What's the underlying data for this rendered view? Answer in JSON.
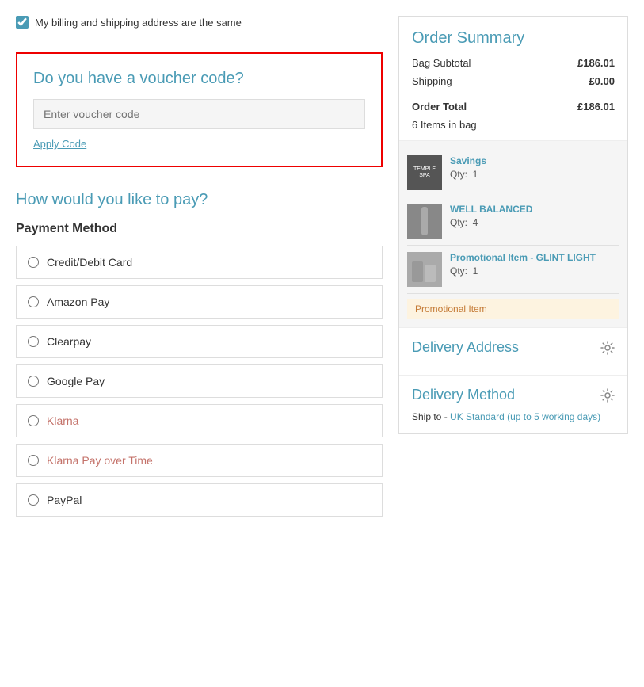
{
  "billing": {
    "checkbox_label": "My billing and shipping address are the same",
    "checked": true
  },
  "voucher": {
    "title": "Do you have a voucher code?",
    "input_placeholder": "Enter voucher code",
    "apply_label": "Apply Code"
  },
  "payment": {
    "how_to_pay_title": "How would you like to pay?",
    "method_title": "Payment Method",
    "options": [
      {
        "id": "credit",
        "label": "Credit/Debit Card",
        "teal": false
      },
      {
        "id": "amazon",
        "label": "Amazon Pay",
        "teal": false
      },
      {
        "id": "clearpay",
        "label": "Clearpay",
        "teal": false
      },
      {
        "id": "googlepay",
        "label": "Google Pay",
        "teal": false
      },
      {
        "id": "klarna",
        "label": "Klarna",
        "teal": true
      },
      {
        "id": "klarna-time",
        "label": "Klarna Pay over Time",
        "teal": true
      },
      {
        "id": "paypal",
        "label": "PayPal",
        "teal": false
      }
    ]
  },
  "order_summary": {
    "title": "Order Summary",
    "bag_subtotal_label": "Bag Subtotal",
    "bag_subtotal_value": "£186.01",
    "shipping_label": "Shipping",
    "shipping_value": "£0.00",
    "order_total_label": "Order Total",
    "order_total_value": "£186.01",
    "items_count_text": "6 Items in bag",
    "items": [
      {
        "name": "Savings",
        "qty_label": "Qty:",
        "qty": "1",
        "thumb_type": "savings",
        "thumb_text": "TEMPLE SPA"
      },
      {
        "name": "WELL BALANCED",
        "qty_label": "Qty:",
        "qty": "4",
        "thumb_type": "well",
        "thumb_text": ""
      },
      {
        "name": "Promotional Item - GLINT LIGHT",
        "qty_label": "Qty:",
        "qty": "1",
        "thumb_type": "promo",
        "thumb_text": ""
      }
    ],
    "promo_badge_text": "Promotional Item"
  },
  "delivery_address": {
    "title": "Delivery Address"
  },
  "delivery_method": {
    "title": "Delivery Method",
    "text": "Ship to - UK Standard (up to 5 working days)"
  }
}
